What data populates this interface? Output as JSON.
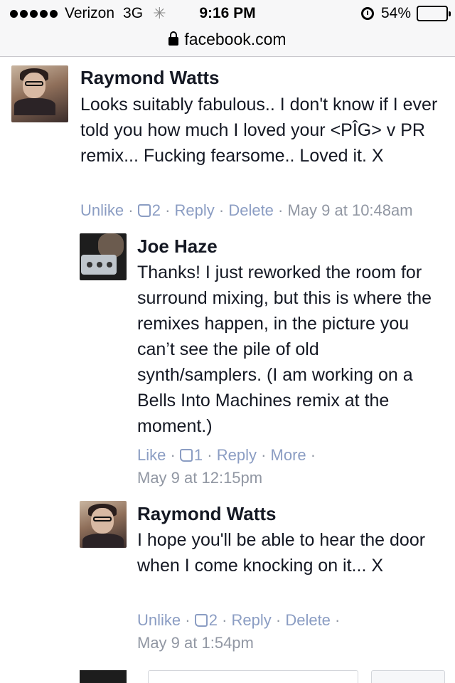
{
  "status_bar": {
    "carrier": "Verizon",
    "network": "3G",
    "time": "9:16 PM",
    "battery": "54%",
    "battery_level": 0.54,
    "signal_bars": 5
  },
  "url_bar": {
    "domain": "facebook.com"
  },
  "comments": [
    {
      "author": "Raymond Watts",
      "text": "Looks suitably fabulous.. I don't know if I ever told you how much I loved your <PÎG> v PR remix... Fucking fearsome.. Loved it. X",
      "like_action": "Unlike",
      "like_count": "2",
      "reply": "Reply",
      "extra_action": "Delete",
      "timestamp": "May 9 at 10:48am"
    },
    {
      "author": "Joe Haze",
      "text": "Thanks! I just reworked the room for surround mixing, but this is where the remixes happen, in the picture you can’t see the pile of old synth/samplers. (I am working on a Bells Into Machines remix at the moment.)",
      "like_action": "Like",
      "like_count": "1",
      "reply": "Reply",
      "extra_action": "More",
      "timestamp": "May 9 at 12:15pm"
    },
    {
      "author": "Raymond Watts",
      "text": "I hope you'll be able to hear the door when I come knocking on it... X",
      "like_action": "Unlike",
      "like_count": "2",
      "reply": "Reply",
      "extra_action": "Delete",
      "timestamp": "May 9 at 1:54pm"
    }
  ],
  "separator": " · ",
  "icons": {
    "like": "thumbs-up-icon",
    "lock": "lock-icon",
    "alarm": "alarm-icon",
    "activity": "activity-spinner-icon"
  },
  "colors": {
    "link": "#8b9dc3",
    "meta": "#9197a3",
    "text": "#141823"
  }
}
